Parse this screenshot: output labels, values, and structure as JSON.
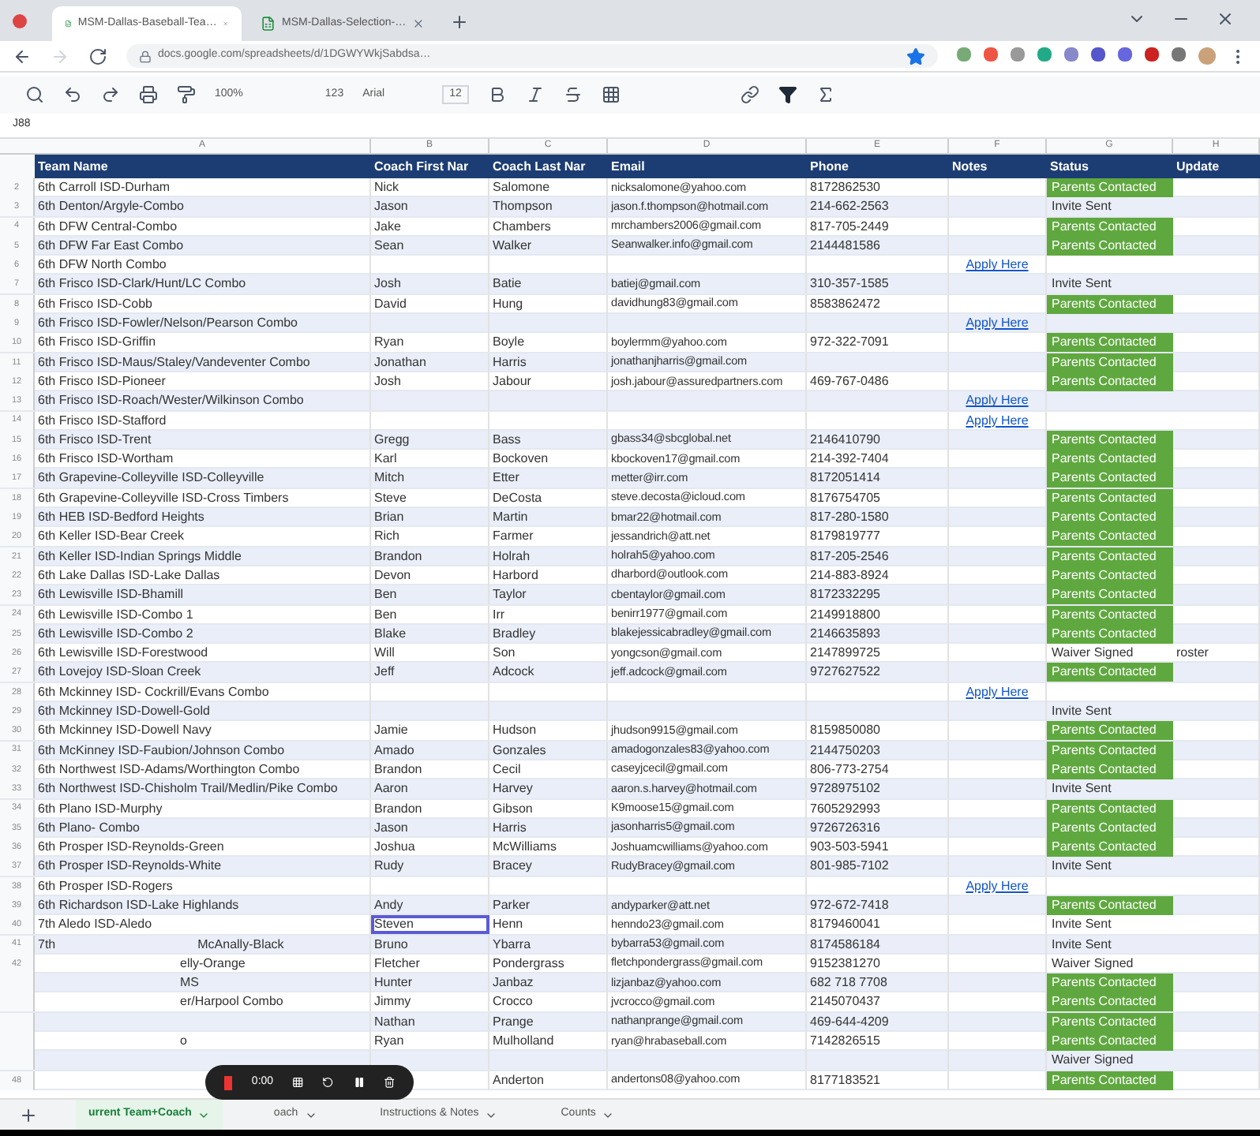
{
  "browser": {
    "tabs": [
      {
        "title": "MSM-Dallas-Baseball-Tea…",
        "selected": true
      },
      {
        "title": "MSM-Dallas-Selection-…",
        "selected": false
      }
    ],
    "url": "docs.google.com/spreadsheets/d/1DGWYWkjSabdsa…"
  },
  "toolbar": {
    "zoom": "100%",
    "number_format": "123",
    "font": "Arial",
    "font_size": "12"
  },
  "formula_bar": {
    "cell": "J88"
  },
  "column_letters": [
    "A",
    "B",
    "C",
    "D",
    "E",
    "F",
    "G",
    "H"
  ],
  "columns": [
    "Team Name",
    "Coach First Nar",
    "Coach Last Nar",
    "Email",
    "Phone",
    "Notes",
    "Status",
    "Update"
  ],
  "rows": [
    {
      "n": "2",
      "team": "6th Carroll ISD-Durham",
      "first": "Nick",
      "last": "Salomone",
      "email": "nicksalomone@yahoo.com",
      "phone": "8172862530",
      "status": {
        "text": "Parents Contacted",
        "kind": "contacted"
      },
      "selected": false
    },
    {
      "n": "3",
      "team": "6th Denton/Argyle-Combo",
      "first": "Jason",
      "last": "Thompson",
      "email": "jason.f.thompson@hotmail.com",
      "phone": "214-662-2563",
      "status": {
        "text": "Invite Sent",
        "kind": "plain"
      },
      "selected": false
    },
    {
      "n": "4",
      "team": "6th DFW Central-Combo",
      "first": "Jake",
      "last": "Chambers",
      "email": "mrchambers2006@gmail.com",
      "phone": "817-705-2449",
      "status": {
        "text": "Parents Contacted",
        "kind": "contacted"
      },
      "selected": false
    },
    {
      "n": "5",
      "team": "6th DFW Far East Combo",
      "first": "Sean",
      "last": "Walker",
      "email": "Seanwalker.info@gmail.com",
      "phone": "2144481586",
      "status": {
        "text": "Parents Contacted",
        "kind": "contacted"
      },
      "selected": false
    },
    {
      "n": "6",
      "team": "6th DFW North Combo",
      "notes": "Apply Here",
      "selected": false
    },
    {
      "n": "7",
      "team": "6th Frisco ISD-Clark/Hunt/LC Combo",
      "first": "Josh",
      "last": "Batie",
      "email": "batiej@gmail.com",
      "phone": "310-357-1585",
      "status": {
        "text": "Invite Sent",
        "kind": "plain"
      },
      "selected": false
    },
    {
      "n": "8",
      "team": "6th Frisco ISD-Cobb",
      "first": "David",
      "last": "Hung",
      "email": "davidhung83@gmail.com",
      "phone": "8583862472",
      "status": {
        "text": "Parents Contacted",
        "kind": "contacted"
      },
      "selected": false
    },
    {
      "n": "9",
      "team": "6th Frisco ISD-Fowler/Nelson/Pearson Combo",
      "notes": "Apply Here",
      "selected": false
    },
    {
      "n": "10",
      "team": "6th Frisco ISD-Griffin",
      "first": "Ryan",
      "last": "Boyle",
      "email": "boylermm@yahoo.com",
      "phone": "972-322-7091",
      "status": {
        "text": "Parents Contacted",
        "kind": "contacted"
      },
      "selected": false
    },
    {
      "n": "11",
      "team": "6th Frisco ISD-Maus/Staley/Vandeventer Combo",
      "first": "Jonathan",
      "last": "Harris",
      "email": "jonathanjharris@gmail.com",
      "status": {
        "text": "Parents Contacted",
        "kind": "contacted"
      },
      "selected": false
    },
    {
      "n": "12",
      "team": "6th Frisco ISD-Pioneer",
      "first": "Josh",
      "last": "Jabour",
      "email": "josh.jabour@assuredpartners.com",
      "phone": "469-767-0486",
      "status": {
        "text": "Parents Contacted",
        "kind": "contacted"
      },
      "selected": false
    },
    {
      "n": "13",
      "team": "6th Frisco ISD-Roach/Wester/Wilkinson Combo",
      "notes": "Apply Here",
      "selected": false
    },
    {
      "n": "14",
      "team": "6th Frisco ISD-Stafford",
      "notes": "Apply Here",
      "selected": false
    },
    {
      "n": "15",
      "team": "6th Frisco ISD-Trent",
      "first": "Gregg",
      "last": "Bass",
      "email": "gbass34@sbcglobal.net",
      "phone": "2146410790",
      "status": {
        "text": "Parents Contacted",
        "kind": "contacted"
      },
      "selected": false
    },
    {
      "n": "16",
      "team": "6th Frisco ISD-Wortham",
      "first": "Karl",
      "last": "Bockoven",
      "email": "kbockoven17@gmail.com",
      "phone": "214-392-7404",
      "status": {
        "text": "Parents Contacted",
        "kind": "contacted"
      },
      "selected": false
    },
    {
      "n": "17",
      "team": "6th Grapevine-Colleyville ISD-Colleyville",
      "first": "Mitch",
      "last": "Etter",
      "email": "metter@irr.com",
      "phone": "8172051414",
      "status": {
        "text": "Parents Contacted",
        "kind": "contacted"
      },
      "selected": false
    },
    {
      "n": "18",
      "team": "6th Grapevine-Colleyville ISD-Cross Timbers",
      "first": "Steve",
      "last": "DeCosta",
      "email": "steve.decosta@icloud.com",
      "phone": "8176754705",
      "status": {
        "text": "Parents Contacted",
        "kind": "contacted"
      },
      "selected": false
    },
    {
      "n": "19",
      "team": "6th HEB ISD-Bedford Heights",
      "first": "Brian",
      "last": "Martin",
      "email": "bmar22@hotmail.com",
      "phone": "817-280-1580",
      "status": {
        "text": "Parents Contacted",
        "kind": "contacted"
      },
      "selected": false
    },
    {
      "n": "20",
      "team": "6th Keller ISD-Bear Creek",
      "first": "Rich",
      "last": "Farmer",
      "email": "jessandrich@att.net",
      "phone": "8179819777",
      "status": {
        "text": "Parents Contacted",
        "kind": "contacted"
      },
      "selected": false
    },
    {
      "n": "21",
      "team": "6th Keller ISD-Indian Springs Middle",
      "first": "Brandon",
      "last": "Holrah",
      "email": "holrah5@yahoo.com",
      "phone": "817-205-2546",
      "status": {
        "text": "Parents Contacted",
        "kind": "contacted"
      },
      "selected": false
    },
    {
      "n": "22",
      "team": "6th Lake Dallas ISD-Lake Dallas",
      "first": "Devon",
      "last": "Harbord",
      "email": "dharbord@outlook.com",
      "phone": "214-883-8924",
      "status": {
        "text": "Parents Contacted",
        "kind": "contacted"
      },
      "selected": false
    },
    {
      "n": "23",
      "team": "6th Lewisville ISD-Bhamill",
      "first": "Ben",
      "last": "Taylor",
      "email": "cbentaylor@gmail.com",
      "phone": "8172332295",
      "status": {
        "text": "Parents Contacted",
        "kind": "contacted"
      },
      "selected": false
    },
    {
      "n": "24",
      "team": "6th Lewisville ISD-Combo 1",
      "first": "Ben",
      "last": "Irr",
      "email": "benirr1977@gmail.com",
      "phone": "2149918800",
      "status": {
        "text": "Parents Contacted",
        "kind": "contacted"
      },
      "selected": false
    },
    {
      "n": "25",
      "team": "6th Lewisville ISD-Combo 2",
      "first": "Blake",
      "last": "Bradley",
      "email": "blakejessicabradley@gmail.com",
      "phone": "2146635893",
      "status": {
        "text": "Parents Contacted",
        "kind": "contacted"
      },
      "selected": false
    },
    {
      "n": "26",
      "team": "6th Lewisville ISD-Forestwood",
      "first": "Will",
      "last": "Son",
      "email": "yongcson@gmail.com",
      "phone": "2147899725",
      "status": {
        "text": "Waiver Signed",
        "kind": "plain"
      },
      "update": "roster",
      "selected": false
    },
    {
      "n": "27",
      "team": "6th Lovejoy ISD-Sloan Creek",
      "first": "Jeff",
      "last": "Adcock",
      "email": "jeff.adcock@gmail.com",
      "phone": "9727627522",
      "status": {
        "text": "Parents Contacted",
        "kind": "contacted"
      },
      "selected": false
    },
    {
      "n": "28",
      "team": "6th Mckinney ISD- Cockrill/Evans Combo",
      "notes": "Apply Here",
      "selected": false
    },
    {
      "n": "29",
      "team": "6th Mckinney ISD-Dowell-Gold",
      "status": {
        "text": "Invite Sent",
        "kind": "plain"
      },
      "selected": false
    },
    {
      "n": "30",
      "team": "6th Mckinney ISD-Dowell Navy",
      "first": "Jamie",
      "last": "Hudson",
      "email": "jhudson9915@gmail.com",
      "phone": "8159850080",
      "status": {
        "text": "Parents Contacted",
        "kind": "contacted"
      },
      "selected": false
    },
    {
      "n": "31",
      "team": "6th McKinney ISD-Faubion/Johnson Combo",
      "first": "Amado",
      "last": "Gonzales",
      "email": "amadogonzales83@yahoo.com",
      "phone": "2144750203",
      "status": {
        "text": "Parents Contacted",
        "kind": "contacted"
      },
      "selected": false
    },
    {
      "n": "32",
      "team": "6th Northwest ISD-Adams/Worthington Combo",
      "first": "Brandon",
      "last": "Cecil",
      "email": "caseyjcecil@gmail.com",
      "phone": "806-773-2754",
      "status": {
        "text": "Parents Contacted",
        "kind": "contacted"
      },
      "selected": false
    },
    {
      "n": "33",
      "team": "6th Northwest ISD-Chisholm Trail/Medlin/Pike Combo",
      "first": "Aaron",
      "last": "Harvey",
      "email": "aaron.s.harvey@hotmail.com",
      "phone": "9728975102",
      "status": {
        "text": "Invite Sent",
        "kind": "plain"
      },
      "selected": false
    },
    {
      "n": "34",
      "team": "6th Plano ISD-Murphy",
      "first": "Brandon",
      "last": "Gibson",
      "email": "K9moose15@gmail.com",
      "phone": "7605292993",
      "status": {
        "text": "Parents Contacted",
        "kind": "contacted"
      },
      "selected": false
    },
    {
      "n": "35",
      "team": "6th Plano- Combo",
      "first": "Jason",
      "last": "Harris",
      "email": "jasonharris5@gmail.com",
      "phone": "9726726316",
      "status": {
        "text": "Parents Contacted",
        "kind": "contacted"
      },
      "selected": false
    },
    {
      "n": "36",
      "team": "6th Prosper ISD-Reynolds-Green",
      "first": "Joshua",
      "last": "McWilliams",
      "email": "Joshuamcwilliams@yahoo.com",
      "phone": "903-503-5941",
      "status": {
        "text": "Parents Contacted",
        "kind": "contacted"
      },
      "selected": false
    },
    {
      "n": "37",
      "team": "6th Prosper ISD-Reynolds-White",
      "first": "Rudy",
      "last": "Bracey",
      "email": "RudyBracey@gmail.com",
      "phone": "801-985-7102",
      "status": {
        "text": "Invite Sent",
        "kind": "plain"
      },
      "selected": false
    },
    {
      "n": "38",
      "team": "6th Prosper ISD-Rogers",
      "notes": "Apply Here",
      "selected": false
    },
    {
      "n": "39",
      "team": "6th Richardson ISD-Lake Highlands",
      "first": "Andy",
      "last": "Parker",
      "email": "andyparker@att.net",
      "phone": "972-672-7418",
      "status": {
        "text": "Parents Contacted",
        "kind": "contacted"
      },
      "selected": false
    },
    {
      "n": "40",
      "team": "7th Aledo ISD-Aledo",
      "first": "Steven",
      "last": "Henn",
      "email": "henndo23@gmail.com",
      "phone": "8179460041",
      "status": {
        "text": "Invite Sent",
        "kind": "plain"
      },
      "selected": true
    },
    {
      "n": "41",
      "team": "7th",
      "team_tail": "McAnally-Black",
      "first": "Bruno",
      "last": "Ybarra",
      "email": "bybarra53@gmail.com",
      "phone": "8174586184",
      "status": {
        "text": "Invite Sent",
        "kind": "plain"
      },
      "selected": false
    },
    {
      "n": "42",
      "team_tail": "elly-Orange",
      "first": "Fletcher",
      "last": "Pondergrass",
      "email": "fletchpondergrass@gmail.com",
      "phone": "9152381270",
      "status": {
        "text": "Waiver Signed",
        "kind": "plain"
      },
      "selected": false
    },
    {
      "team_tail": "MS",
      "first": "Hunter",
      "last": "Janbaz",
      "email": "lizjanbaz@yahoo.com",
      "phone": "682 718 7708",
      "status": {
        "text": "Parents Contacted",
        "kind": "contacted"
      },
      "selected": false
    },
    {
      "team_tail": "er/Harpool Combo",
      "first": "Jimmy",
      "last": "Crocco",
      "email": "jvcrocco@gmail.com",
      "phone": "2145070437",
      "status": {
        "text": "Parents Contacted",
        "kind": "contacted"
      },
      "selected": false
    },
    {
      "first": "Nathan",
      "last": "Prange",
      "email": "nathanprange@gmail.com",
      "phone": "469-644-4209",
      "status": {
        "text": "Parents Contacted",
        "kind": "contacted"
      },
      "selected": false
    },
    {
      "team_tail": "o",
      "first": "Ryan",
      "last": "Mulholland",
      "email": "ryan@hrabaseball.com",
      "phone": "7142826515",
      "status": {
        "text": "Parents Contacted",
        "kind": "contacted"
      },
      "selected": false
    },
    {
      "status": {
        "text": "Waiver Signed",
        "kind": "plain"
      },
      "selected": false
    },
    {
      "n": "48",
      "last": "Anderton",
      "email": "andertons08@yahoo.com",
      "phone": "8177183521",
      "status": {
        "text": "Parents Contacted",
        "kind": "contacted"
      },
      "selected": false
    }
  ],
  "sheet_tabs": [
    {
      "label": "urrent Team+Coach",
      "selected": true
    },
    {
      "label": "oach",
      "selected": false
    },
    {
      "label": "Instructions & Notes",
      "selected": false
    },
    {
      "label": "Counts",
      "selected": false
    }
  ],
  "recorder": {
    "time": "0:00"
  }
}
